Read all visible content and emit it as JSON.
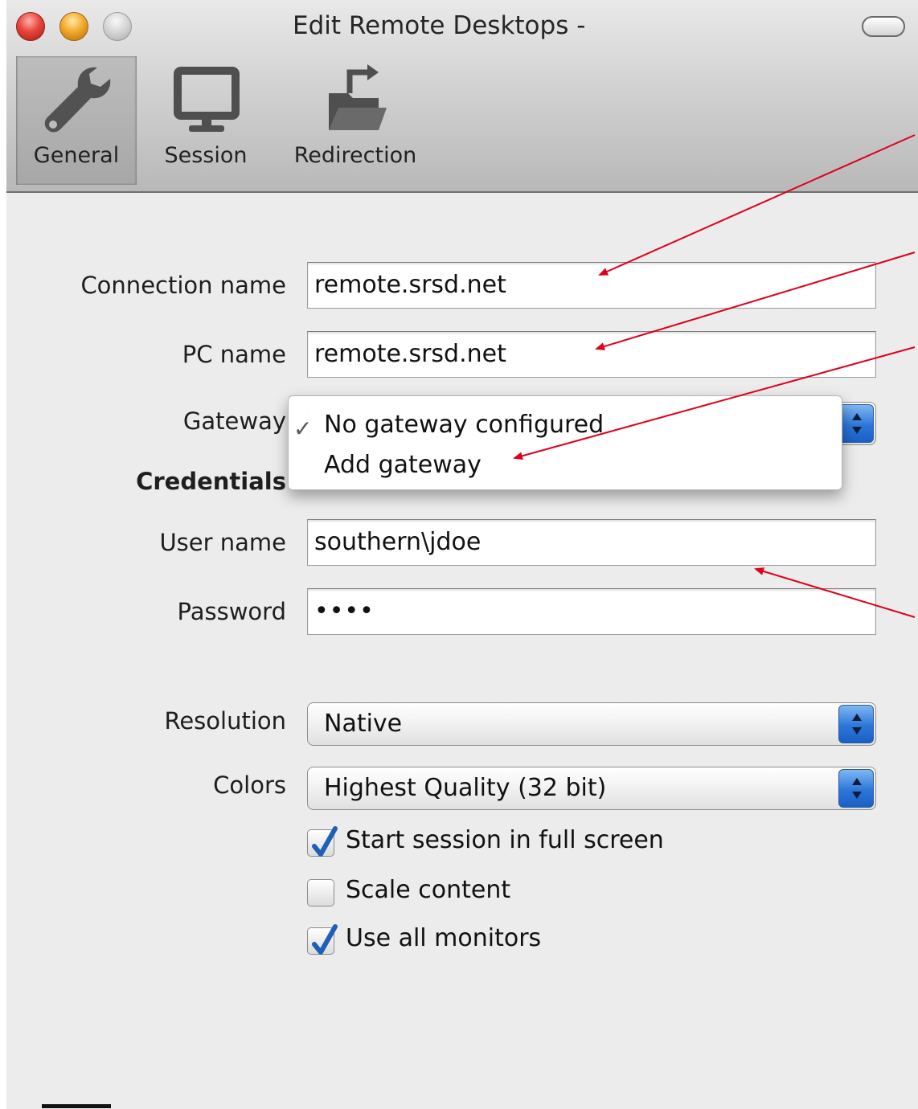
{
  "window": {
    "title": "Edit Remote Desktops -"
  },
  "toolbar": {
    "tabs": [
      {
        "label": "General",
        "icon": "wrench-icon",
        "selected": true
      },
      {
        "label": "Session",
        "icon": "monitor-icon",
        "selected": false
      },
      {
        "label": "Redirection",
        "icon": "folder-redirect-icon",
        "selected": false
      }
    ]
  },
  "form": {
    "connection_name_label": "Connection name",
    "connection_name_value": "remote.srsd.net",
    "pc_name_label": "PC name",
    "pc_name_value": "remote.srsd.net",
    "gateway_label": "Gateway",
    "credentials_label": "Credentials",
    "user_name_label": "User name",
    "user_name_value": "southern\\jdoe",
    "password_label": "Password",
    "password_value": "••••",
    "resolution_label": "Resolution",
    "resolution_value": "Native",
    "colors_label": "Colors",
    "colors_value": "Highest Quality (32 bit)",
    "checkboxes": [
      {
        "label": "Start session in full screen",
        "checked": true
      },
      {
        "label": "Scale content",
        "checked": false
      },
      {
        "label": "Use all monitors",
        "checked": true
      }
    ]
  },
  "gateway_menu": {
    "items": [
      {
        "label": "No gateway configured",
        "checked": true
      },
      {
        "label": "Add gateway",
        "checked": false
      }
    ]
  },
  "colors": {
    "annotation_arrow": "#e0001b",
    "stepper_blue": "#2d76d9",
    "check_blue": "#1f5fb8"
  }
}
